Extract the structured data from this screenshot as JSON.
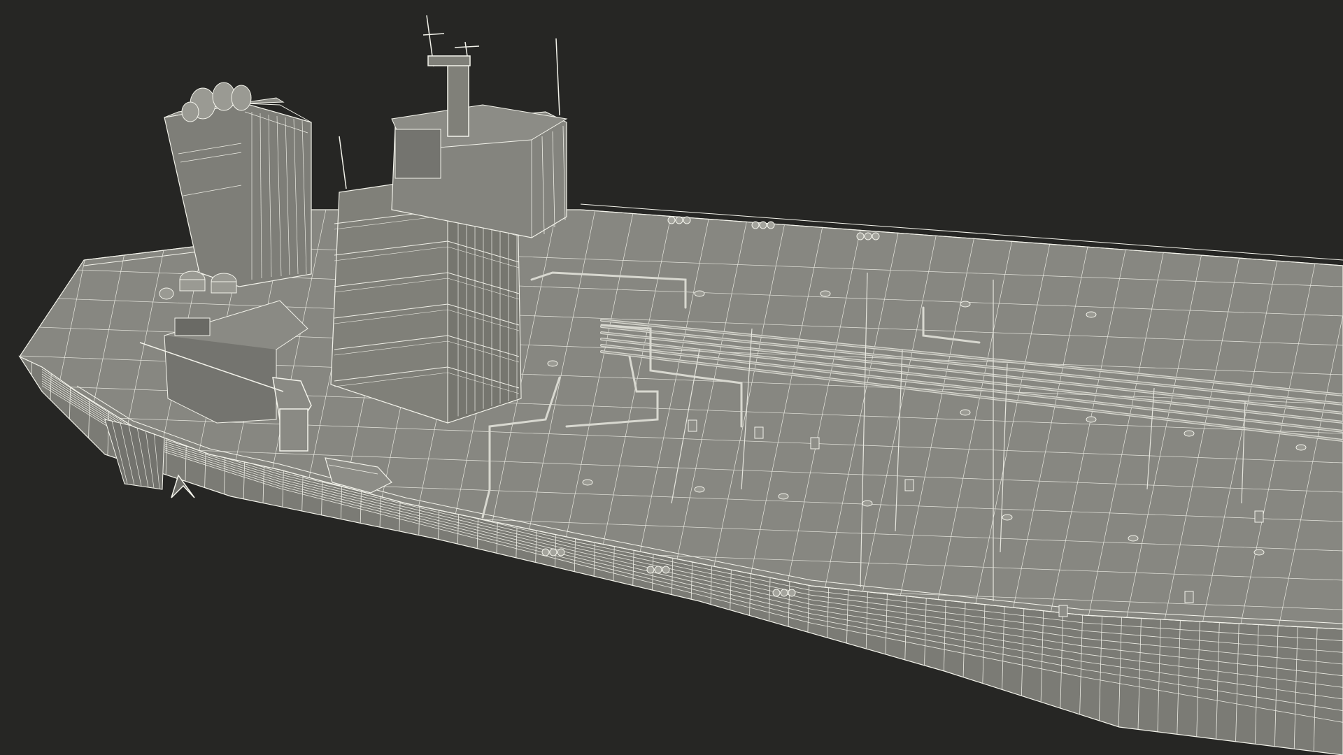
{
  "scene": {
    "subject": "oil-tanker-wireframe-render",
    "colors": {
      "background": "#262624",
      "hull": "#7f7f79",
      "hull_dark": "#6b6b66",
      "deck": "#8a8a84",
      "structure": "#84847e",
      "structure_dark": "#6e6e69",
      "wire": "#f2f2ea",
      "pipe": "#d8d8d0"
    }
  }
}
